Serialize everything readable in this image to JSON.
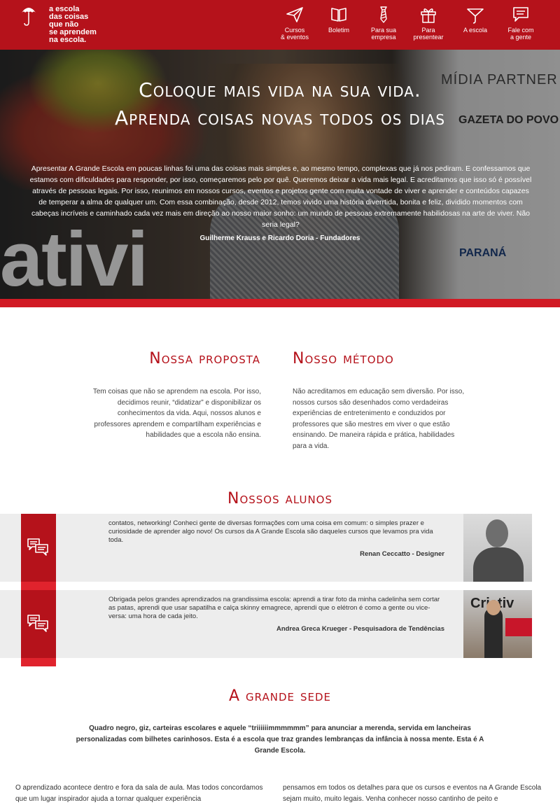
{
  "header": {
    "logo_text": "a escola\ndas coisas\nque não\nse aprendem\nna escola.",
    "nav": [
      {
        "label": "Cursos\n& eventos",
        "icon": "paper-plane-icon"
      },
      {
        "label": "Boletim",
        "icon": "book-icon"
      },
      {
        "label": "Para sua\nempresa",
        "icon": "tie-icon"
      },
      {
        "label": "Para\npresentear",
        "icon": "gift-icon"
      },
      {
        "label": "A escola",
        "icon": "umbrella-icon"
      },
      {
        "label": "Fale com\na gente",
        "icon": "speech-bubble-icon"
      }
    ]
  },
  "hero": {
    "title_line1": "Coloque mais vida na sua vida.",
    "title_line2": "Aprenda coisas novas todos os dias",
    "text": "Apresentar A Grande Escola em poucas linhas foi uma das coisas mais simples e, ao mesmo tempo, complexas que já nos pediram. E confessamos que estamos com dificuldades para responder, por isso, começaremos pelo por quê. Queremos deixar a vida mais legal. E acreditamos que isso só é possível através de pessoas legais. Por isso, reunimos em nossos cursos, eventos e projetos gente com muita vontade de viver e aprender e conteúdos capazes de temperar a alma de qualquer um. Com essa combinação, desde 2012, temos vivido uma história diverrtida, bonita e feliz, dividido momentos com cabeças incríveis e caminhado cada vez mais em direção ao nosso maior sonho: um mundo de pessoas extremamente habilidosas na arte de viver. Não seria legal?",
    "author": "Guilherme Krauss e Ricardo Doria - Fundadores",
    "bg_midia": "MÍDIA PARTNER",
    "bg_gazeta": "GAZETA DO POVO",
    "bg_parana": "PARANÁ",
    "bg_ativi": "ativi"
  },
  "proposta": {
    "title": "Nossa proposta",
    "text": "Tem coisas que não se aprendem na escola. Por isso, decidimos reunir, “didatizar” e disponibilizar os conhecimentos da vida. Aqui, nossos alunos e professores aprendem e compartilham experiências e habilidades que a escola não ensina."
  },
  "metodo": {
    "title": "Nosso método",
    "text": "Não acreditamos em educação sem diversão. Por isso, nossos cursos são desenhados como verdadeiras experiências de entretenimento e conduzidos por professores que são mestres em viver o que estão ensinando. De maneira rápida e prática, habilidades para a vida."
  },
  "alunos": {
    "title": "Nossos alunos",
    "testimonials": [
      {
        "text": "contatos, networking! Conheci gente de diversas formações com uma coisa em comum: o simples prazer e curiosidade de aprender algo novo! Os cursos da A Grande Escola são daqueles cursos que levamos pra vida toda.",
        "author": "Renan Ceccatto - Designer"
      },
      {
        "text": "Obrigada pelos grandes aprendizados na grandissima escola: aprendi a tirar foto da minha cadelinha sem cortar as patas, aprendi que usar sapatilha e calça skinny emagrece, aprendi que o elétron é como a gente ou vice-versa: uma hora de cada jeito.",
        "author": "Andrea Greca Krueger - Pesquisadora de Tendências",
        "photo_text": "Criativ"
      }
    ]
  },
  "sede": {
    "title": "A grande sede",
    "text": "Quadro negro, giz, carteiras escolares e aquele “triiiiiimmmmmm” para anunciar a merenda, servida em lancheiras personalizadas com bilhetes carinhosos. Esta é a escola que traz grandes lembranças da infância à nossa mente. Esta é A Grande Escola.",
    "bottom_left": "O aprendizado acontece dentro e fora da sala de aula. Mas todos concordamos que um lugar inspirador ajuda a tornar qualquer experiência",
    "bottom_right": "pensamos em todos os detalhes para que os cursos e eventos na A Grande Escola sejam muito, muito legais. Venha conhecer nosso cantinho de peito e"
  },
  "colors": {
    "brand_red": "#b5121b",
    "accent_red": "#e0232d",
    "testimonial_bg": "#ededed"
  }
}
